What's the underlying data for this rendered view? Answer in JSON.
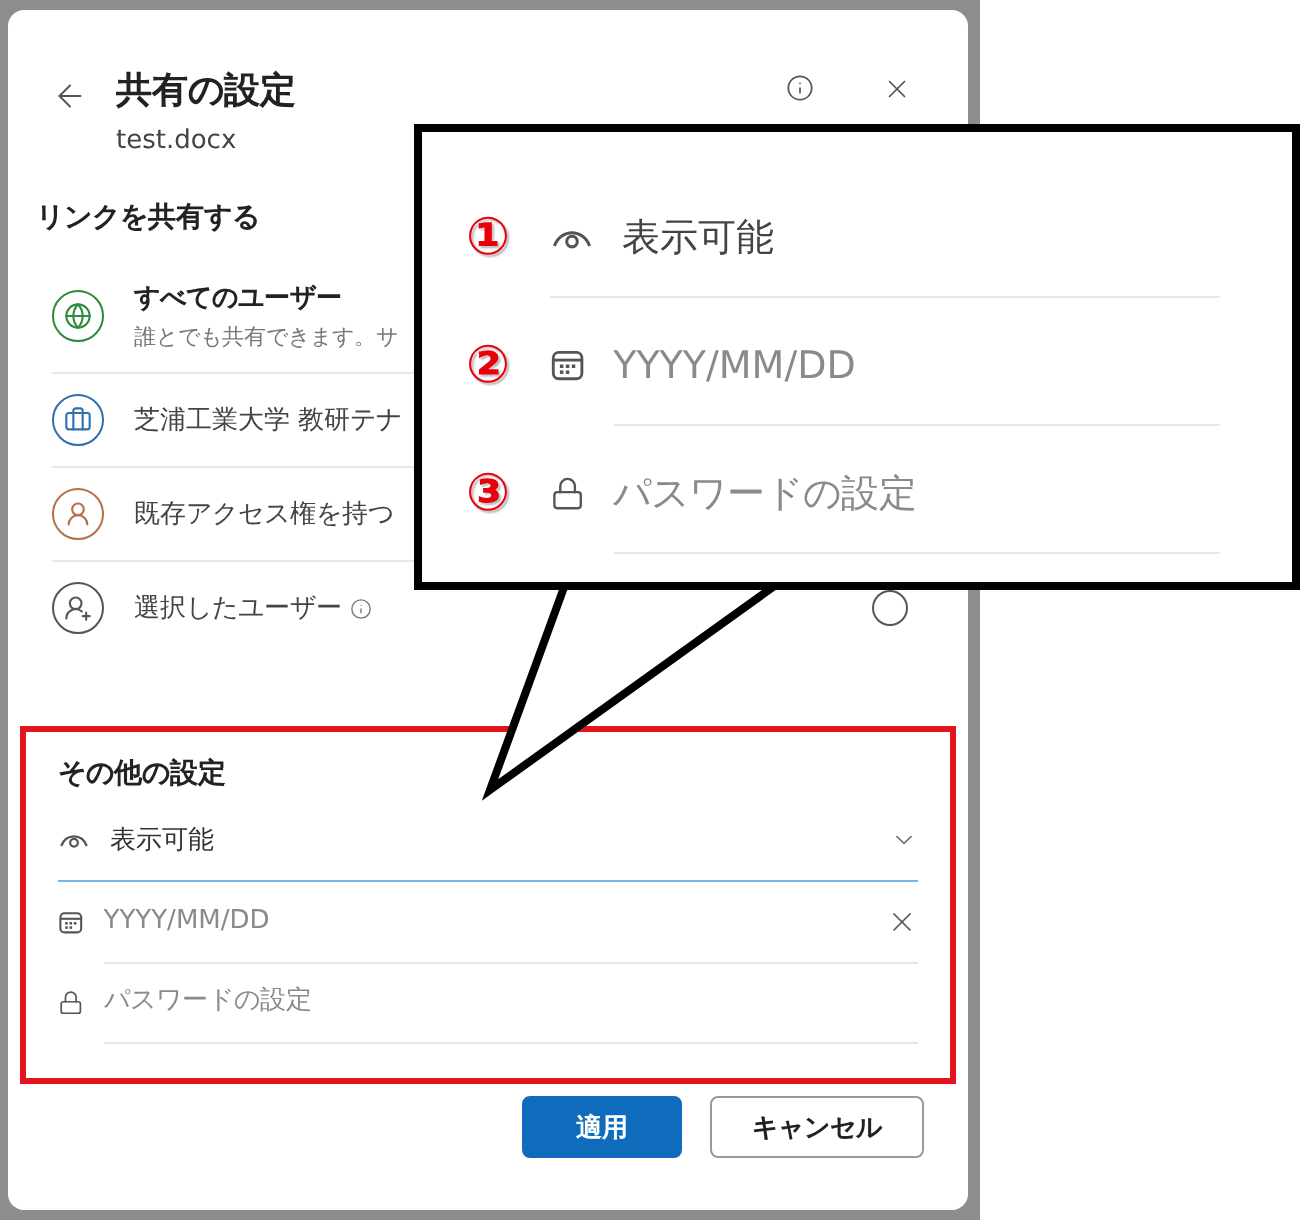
{
  "dialog": {
    "title": "共有の設定",
    "file_name": "test.docx",
    "link_section": {
      "heading": "リンクを共有する",
      "options": [
        {
          "kind": "globe",
          "color": "#2e8b3a",
          "label": "すべてのユーザー",
          "description": "誰とでも共有できます。サ"
        },
        {
          "kind": "briefcase",
          "color": "#2f6fb0",
          "label": "芝浦工業大学 教研テナ"
        },
        {
          "kind": "person",
          "color": "#b5704a",
          "label": "既存アクセス権を持つ"
        },
        {
          "kind": "person-add",
          "color": "#555555",
          "label": "選択したユーザー",
          "info": true,
          "selected": false
        }
      ]
    },
    "other_settings": {
      "heading": "その他の設定",
      "fields": [
        {
          "kind": "permission",
          "value": "表示可能"
        },
        {
          "kind": "date",
          "placeholder": "YYYY/MM/DD"
        },
        {
          "kind": "password",
          "placeholder": "パスワードの設定"
        }
      ]
    },
    "buttons": [
      {
        "kind": "primary",
        "label": "適用"
      },
      {
        "kind": "secondary",
        "label": "キャンセル"
      }
    ]
  },
  "callout": {
    "items": [
      {
        "number": "①",
        "kind": "permission",
        "value": "表示可能"
      },
      {
        "number": "②",
        "kind": "date",
        "placeholder": "YYYY/MM/DD"
      },
      {
        "number": "③",
        "kind": "password",
        "placeholder": "パスワードの設定"
      }
    ]
  }
}
